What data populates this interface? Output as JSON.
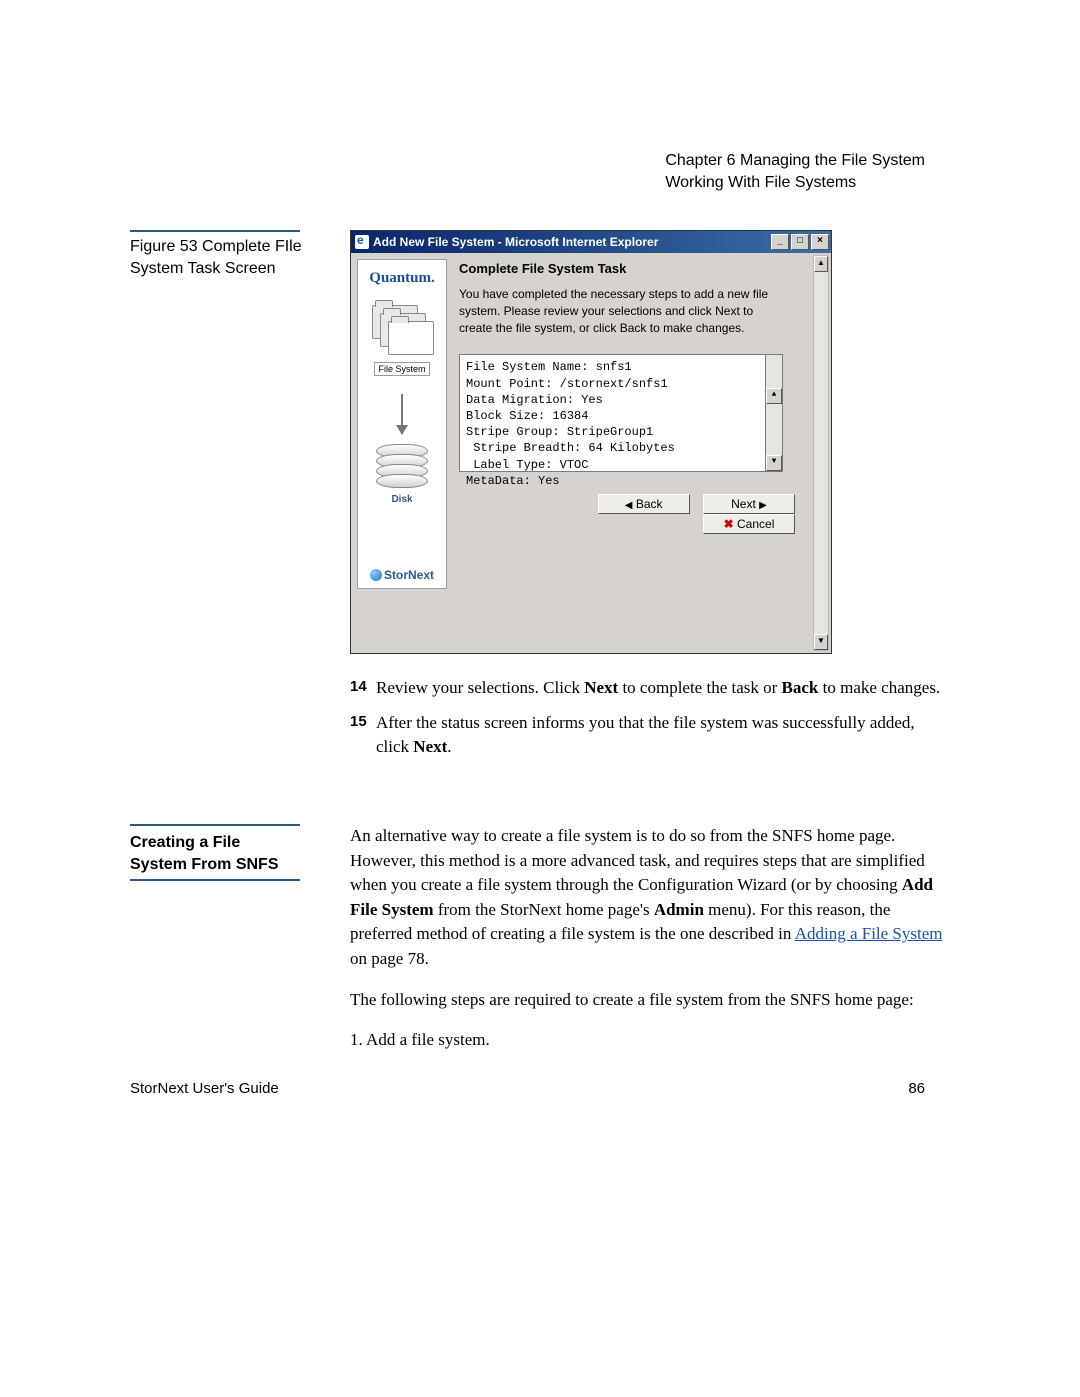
{
  "header": {
    "chapter": "Chapter 6  Managing the File System",
    "section": "Working With File Systems"
  },
  "figure": {
    "caption_line1": "Figure 53  Complete FIle",
    "caption_line2": "System Task Screen"
  },
  "window": {
    "title": "Add New File System - Microsoft Internet Explorer",
    "min": "_",
    "restore": "□",
    "close": "×",
    "brand": "Quantum.",
    "fs_label": "File System",
    "disk_label": "Disk",
    "product": "StorNext",
    "heading": "Complete File System Task",
    "intro": "You have completed the necessary steps to add a new file system. Please review your selections and click Next to create the file system, or click Back to make changes.",
    "summary": "File System Name: snfs1\nMount Point: /stornext/snfs1\nData Migration: Yes\nBlock Size: 16384\nStripe Group: StripeGroup1\n Stripe Breadth: 64 Kilobytes\n Label Type: VTOC\nMetaData: Yes",
    "scroll_up": "▲",
    "scroll_down": "▼",
    "back": "Back",
    "next": "Next",
    "cancel": "Cancel"
  },
  "steps": {
    "n14": "14",
    "t14a": "Review your selections. Click ",
    "t14_next": "Next",
    "t14b": " to complete the task or ",
    "t14_back": "Back",
    "t14c": " to make changes.",
    "n15": "15",
    "t15a": "After the status screen informs you that the file system was successfully added, click ",
    "t15_next": "Next",
    "t15b": "."
  },
  "section2": {
    "label": "Creating a File System From SNFS",
    "p1a": "An alternative way to create a file system is to do so from the SNFS home page. However, this method is a more advanced task, and requires steps that are simplified when you create a file system through the Configuration Wizard (or by choosing ",
    "p1_bold1": "Add File System",
    "p1b": " from the StorNext home page's ",
    "p1_bold2": "Admin",
    "p1c": " menu). For this reason, the preferred method of creating a file system is the one described in ",
    "p1_link": "Adding a File System",
    "p1d": " on page  78.",
    "p2": "The following steps are required to create a file system from the SNFS home page:",
    "p3": "1. Add a file system."
  },
  "footer": {
    "left": "StorNext User's Guide",
    "right": "86"
  }
}
